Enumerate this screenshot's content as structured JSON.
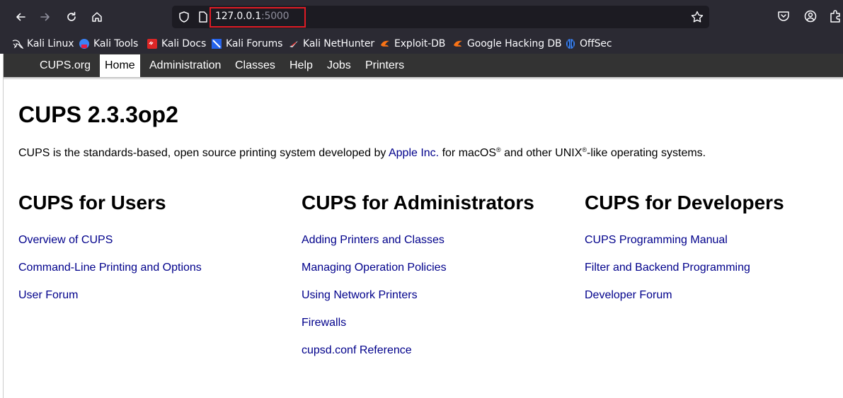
{
  "browser": {
    "url_host": "127.0.0.1",
    "url_port": ":5000",
    "bookmarks": [
      {
        "label": "Kali Linux",
        "icon": "kali-dragon-icon"
      },
      {
        "label": "Kali Tools",
        "icon": "kali-tools-icon"
      },
      {
        "label": "Kali Docs",
        "icon": "kali-docs-icon"
      },
      {
        "label": "Kali Forums",
        "icon": "kali-forums-icon"
      },
      {
        "label": "Kali NetHunter",
        "icon": "kali-nethunter-icon"
      },
      {
        "label": "Exploit-DB",
        "icon": "exploit-db-icon"
      },
      {
        "label": "Google Hacking DB",
        "icon": "google-hacking-db-icon"
      },
      {
        "label": "OffSec",
        "icon": "offsec-icon"
      }
    ]
  },
  "cups_nav": {
    "items": [
      {
        "label": "CUPS.org"
      },
      {
        "label": "Home"
      },
      {
        "label": "Administration"
      },
      {
        "label": "Classes"
      },
      {
        "label": "Help"
      },
      {
        "label": "Jobs"
      },
      {
        "label": "Printers"
      }
    ],
    "active": "Home"
  },
  "main": {
    "title": "CUPS 2.3.3op2",
    "intro_before": "CUPS is the standards-based, open source printing system developed by ",
    "intro_link": "Apple Inc.",
    "intro_mid1": " for macOS",
    "intro_reg1": "®",
    "intro_mid2": " and other UNIX",
    "intro_reg2": "®",
    "intro_after": "-like operating systems.",
    "columns": [
      {
        "title": "CUPS for Users",
        "links": [
          "Overview of CUPS",
          "Command-Line Printing and Options",
          "User Forum"
        ]
      },
      {
        "title": "CUPS for Administrators",
        "links": [
          "Adding Printers and Classes",
          "Managing Operation Policies",
          "Using Network Printers",
          "Firewalls",
          "cupsd.conf Reference"
        ]
      },
      {
        "title": "CUPS for Developers",
        "links": [
          "CUPS Programming Manual",
          "Filter and Backend Programming",
          "Developer Forum"
        ]
      }
    ]
  },
  "colors": {
    "browser_chrome": "#2b2a33",
    "urlbar": "#1c1b22",
    "url_highlight": "#e01b24",
    "cups_nav": "#333333",
    "link": "#00008b"
  }
}
